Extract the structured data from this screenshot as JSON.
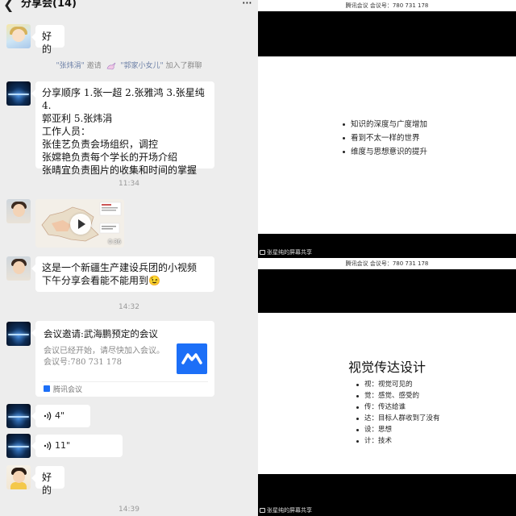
{
  "chat": {
    "title": "分享会(14)",
    "back_icon": "chevron-left-icon",
    "more_icon": "more-dots-icon",
    "messages": {
      "m1_text": "好的",
      "sys_inviter": "\"张炜涓\"",
      "sys_invite_verb": "邀请",
      "sys_invitee": "\"郭家小女儿\"",
      "sys_suffix": "加入了群聊",
      "m2_line1": "分享顺序 1.张一超 2.张雅鸿 3.张星纯 4.",
      "m2_line2": "郭亚利 5.张炜涓",
      "m2_line3": "工作人员：",
      "m2_line4": "张佳艺负责会场组织，调控",
      "m2_line5": "张嫦艳负责每个学长的开场介绍",
      "m2_line6": "张晴宜负责图片的收集和时间的掌握",
      "time1": "11:34",
      "video_duration": "0:36",
      "m4_line1": "这是一个新疆生产建设兵团的小视频",
      "m4_line2": "下午分享会看能不能用到",
      "m4_emoji": "😉",
      "time2": "14:32",
      "meet_title": "会议邀请:武海鹏预定的会议",
      "meet_desc1": "会议已经开始，请尽快加入会议。",
      "meet_desc2": "会议号:780 731 178",
      "meet_source": "腾讯会议",
      "voice1": "4\"",
      "voice2": "11\"",
      "m8_text": "好的",
      "time3": "14:39"
    }
  },
  "slides": {
    "meeting_bar": "腾讯会议  会议号：780 731 178",
    "slide1_bullets": [
      "知识的深度与广度增加",
      "看到不太一样的世界",
      "维度与思想意识的提升"
    ],
    "slide2_title": "视觉传达设计",
    "slide2_bullets": [
      "视：视觉可见的",
      "觉：感觉、感受的",
      "传：传达给谁",
      "达：目标人群收到了没有",
      "设：思想",
      "计：技术"
    ],
    "share_label": "张星纯的屏幕共享"
  },
  "colors": {
    "chat_bg": "#ededed",
    "bubble": "#ffffff",
    "meeting_blue": "#1c6ff7",
    "sys_name": "#6b7fa6"
  }
}
